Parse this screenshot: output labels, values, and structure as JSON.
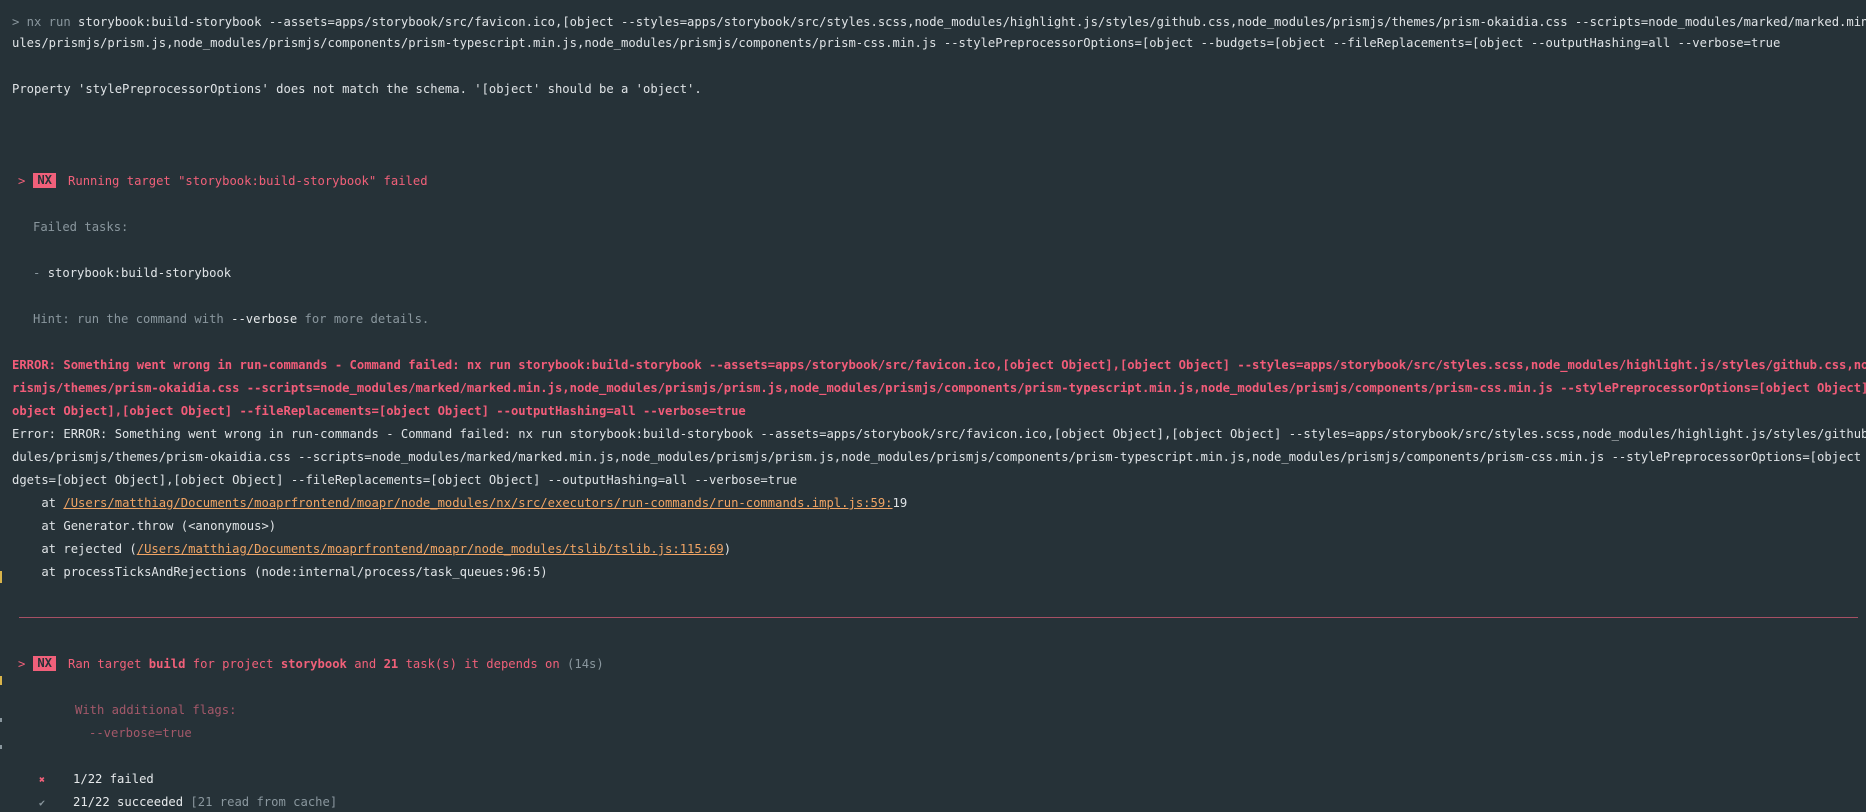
{
  "cmd_prompt": "> nx run ",
  "cmd_line1": "storybook:build-storybook --assets=apps/storybook/src/favicon.ico,[object --styles=apps/storybook/src/styles.scss,node_modules/highlight.js/styles/github.css,node_modules/prismjs/themes/prism-okaidia.css --scripts=node_modules/marked/marked.min.js,node_mo",
  "cmd_line2": "ules/prismjs/prism.js,node_modules/prismjs/components/prism-typescript.min.js,node_modules/prismjs/components/prism-css.min.js --stylePreprocessorOptions=[object --budgets=[object --fileReplacements=[object --outputHashing=all --verbose=true",
  "schema_error": "Property 'stylePreprocessorOptions' does not match the schema. '[object' should be a 'object'.",
  "run_failed": {
    "arrow": ">",
    "badge": "NX",
    "message": "Running target \"storybook:build-storybook\" failed",
    "failed_tasks_label": "Failed tasks:",
    "task_dash": "-",
    "task_name": "storybook:build-storybook",
    "hint_prefix": "Hint: run the command with ",
    "hint_flag": "--verbose",
    "hint_suffix": " for more details."
  },
  "error_block": {
    "line1": "ERROR: Something went wrong in run-commands - Command failed: nx run storybook:build-storybook --assets=apps/storybook/src/favicon.ico,[object Object],[object Object] --styles=apps/storybook/src/styles.scss,node_modules/highlight.js/styles/github.css,node_modules/p",
    "line2": "rismjs/themes/prism-okaidia.css --scripts=node_modules/marked/marked.min.js,node_modules/prismjs/prism.js,node_modules/prismjs/components/prism-typescript.min.js,node_modules/prismjs/components/prism-css.min.js --stylePreprocessorOptions=[object Object] --budgets=[",
    "line3": "object Object],[object Object] --fileReplacements=[object Object] --outputHashing=all --verbose=true"
  },
  "error_plain": {
    "line1": "Error: ERROR: Something went wrong in run-commands - Command failed: nx run storybook:build-storybook --assets=apps/storybook/src/favicon.ico,[object Object],[object Object] --styles=apps/storybook/src/styles.scss,node_modules/highlight.js/styles/github.css,node_mo",
    "line2": "dules/prismjs/themes/prism-okaidia.css --scripts=node_modules/marked/marked.min.js,node_modules/prismjs/prism.js,node_modules/prismjs/components/prism-typescript.min.js,node_modules/prismjs/components/prism-css.min.js --stylePreprocessorOptions=[object Object] --bu",
    "line3": "dgets=[object Object],[object Object] --fileReplacements=[object Object] --outputHashing=all --verbose=true"
  },
  "stack": [
    {
      "prefix": "    at ",
      "link": "/Users/matthiag/Documents/moaprfrontend/moapr/node_modules/nx/src/executors/run-commands/run-commands.impl.js:59:",
      "suffix": "19"
    },
    {
      "prefix": "    at Generator.throw (<anonymous>)"
    },
    {
      "prefix": "    at rejected (",
      "link": "/Users/matthiag/Documents/moaprfrontend/moapr/node_modules/tslib/tslib.js:115:69",
      "suffix": ")"
    },
    {
      "prefix": "    at processTicksAndRejections (node:internal/process/task_queues:96:5)"
    }
  ],
  "summary": {
    "arrow": ">",
    "badge": "NX",
    "t1": "Ran target ",
    "target": "build",
    "t2": " for project ",
    "project": "storybook",
    "t3": " and ",
    "count": "21",
    "t4": " task(s) it depends on ",
    "duration": "(14s)",
    "flags_label": "With additional flags:",
    "flag": "--verbose=true",
    "failed_icon": "✖",
    "failed_text": "1/22 failed",
    "success_icon": "✔",
    "success_text": "21/22 succeeded",
    "cache_text": " [21 read from cache]"
  },
  "colors": {
    "background": "#263238",
    "error_red": "#f25c79",
    "link_orange": "#f0a464"
  }
}
